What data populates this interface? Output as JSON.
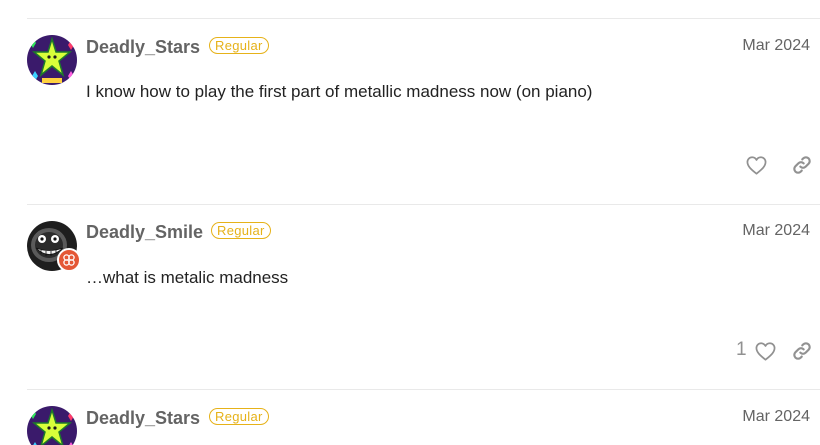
{
  "posts": [
    {
      "username": "Deadly_Stars",
      "badge": "Regular",
      "date": "Mar 2024",
      "body": "I know how to play the first part of metallic madness now (on piano)",
      "likes": "",
      "avatar_icon": "star-avatar-icon"
    },
    {
      "username": "Deadly_Smile",
      "badge": "Regular",
      "date": "Mar 2024",
      "body": "…what is metalic madness",
      "likes": "1",
      "avatar_icon": "smile-avatar-icon",
      "flair_icon": "flair-icon"
    },
    {
      "username": "Deadly_Stars",
      "badge": "Regular",
      "date": "Mar 2024",
      "body": "",
      "likes": "",
      "avatar_icon": "star-avatar-icon"
    }
  ],
  "colors": {
    "badge": "#e6b219",
    "username": "#646464",
    "flair": "#e45735",
    "icon": "#919191"
  }
}
